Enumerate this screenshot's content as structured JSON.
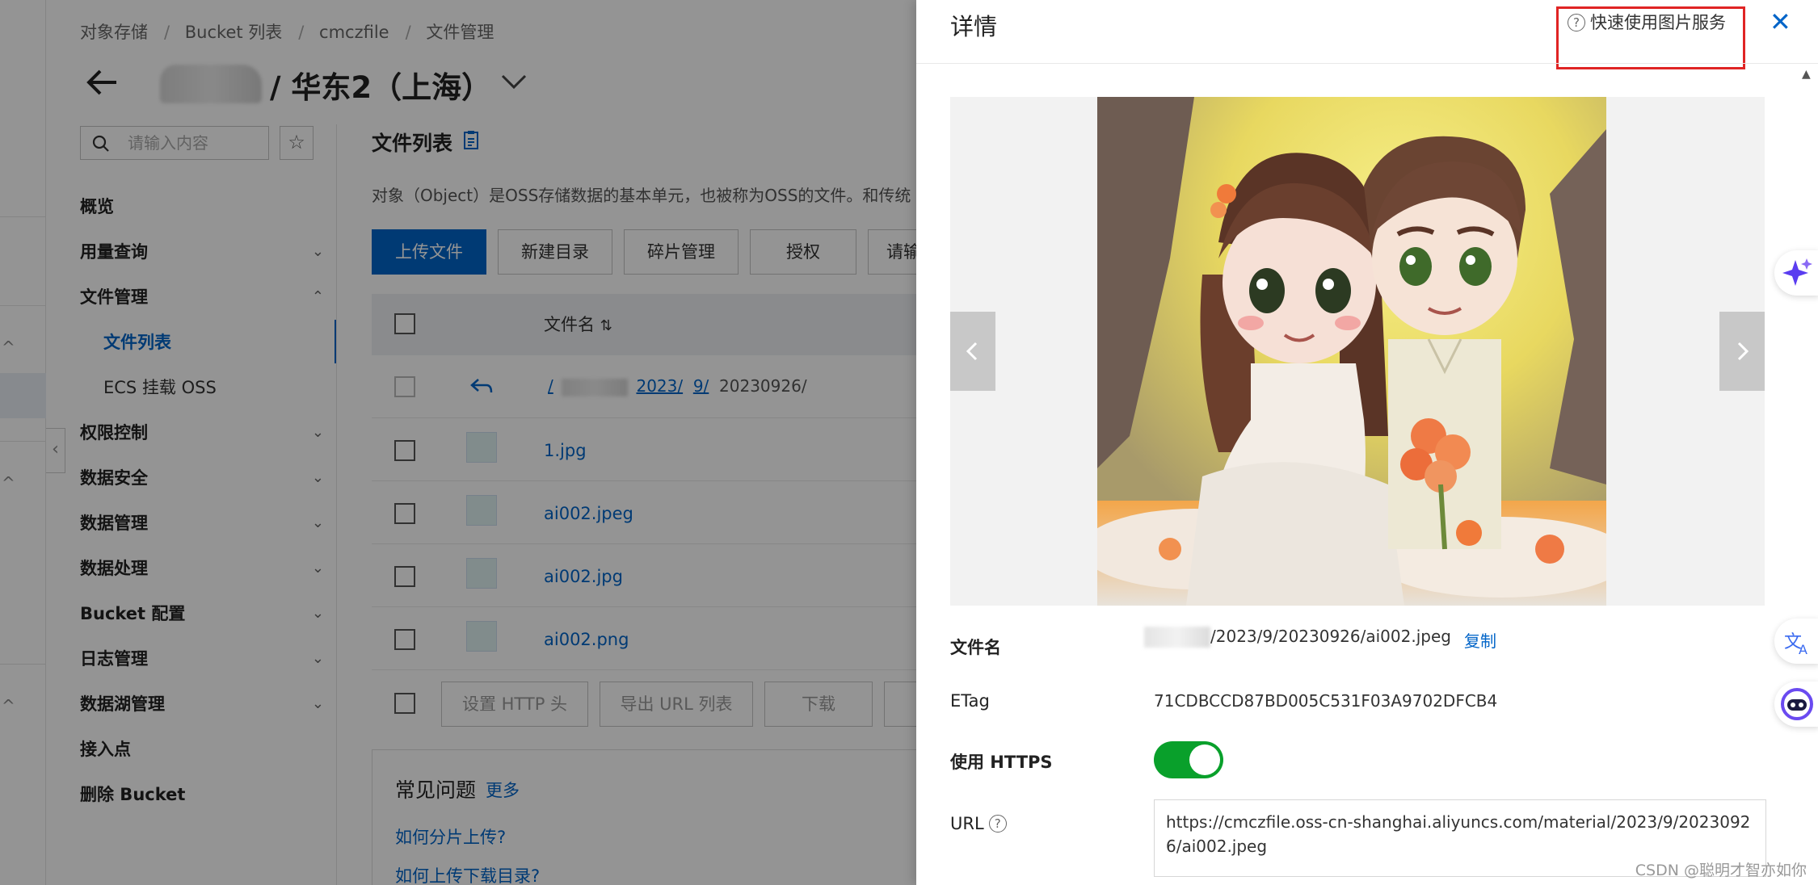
{
  "breadcrumb": [
    "对象存储",
    "Bucket 列表",
    "cmczfile",
    "文件管理"
  ],
  "header": {
    "title": "/ 华东2（上海）"
  },
  "sidebar": {
    "search_placeholder": "请输入内容",
    "items": [
      {
        "label": "概览"
      },
      {
        "label": "用量查询"
      },
      {
        "label": "文件管理"
      },
      {
        "label": "文件列表"
      },
      {
        "label": "ECS 挂载 OSS"
      },
      {
        "label": "权限控制"
      },
      {
        "label": "数据安全"
      },
      {
        "label": "数据管理"
      },
      {
        "label": "数据处理"
      },
      {
        "label": "Bucket 配置"
      },
      {
        "label": "日志管理"
      },
      {
        "label": "数据湖管理"
      },
      {
        "label": "接入点"
      },
      {
        "label": "删除 Bucket"
      }
    ]
  },
  "content": {
    "title": "文件列表",
    "description": "对象（Object）是OSS存储数据的基本单元，也被称为OSS的文件。和传统",
    "buttons": [
      "上传文件",
      "新建目录",
      "碎片管理",
      "授权",
      "请输"
    ],
    "table_header": "文件名",
    "path": {
      "root": "/",
      "year": "2023/",
      "month": "9/",
      "current": "20230926/"
    },
    "files": [
      "1.jpg",
      "ai002.jpeg",
      "ai002.jpg",
      "ai002.png"
    ],
    "bottom_buttons": [
      "设置 HTTP 头",
      "导出 URL 列表",
      "下载"
    ],
    "faq": {
      "title": "常见问题",
      "more": "更多",
      "questions": [
        "如何分片上传?",
        "如何上传下载目录?"
      ]
    }
  },
  "drawer": {
    "title": "详情",
    "help_link": "快速使用图片服务",
    "filename_label": "文件名",
    "filename_value": "/2023/9/20230926/ai002.jpeg",
    "copy_label": "复制",
    "etag_label": "ETag",
    "etag_value": "71CDBCCD87BD005C531F03A9702DFCB4",
    "https_label": "使用 HTTPS",
    "https_enabled": true,
    "url_label": "URL",
    "url_value": "https://cmczfile.oss-cn-shanghai.aliyuncs.com/material/2023/9/20230926/ai002.jpeg"
  },
  "watermark": "CSDN @聪明才智亦如你",
  "colors": {
    "accent": "#0064c8",
    "toggle_on": "#09a02b",
    "highlight_box": "#e02424"
  }
}
